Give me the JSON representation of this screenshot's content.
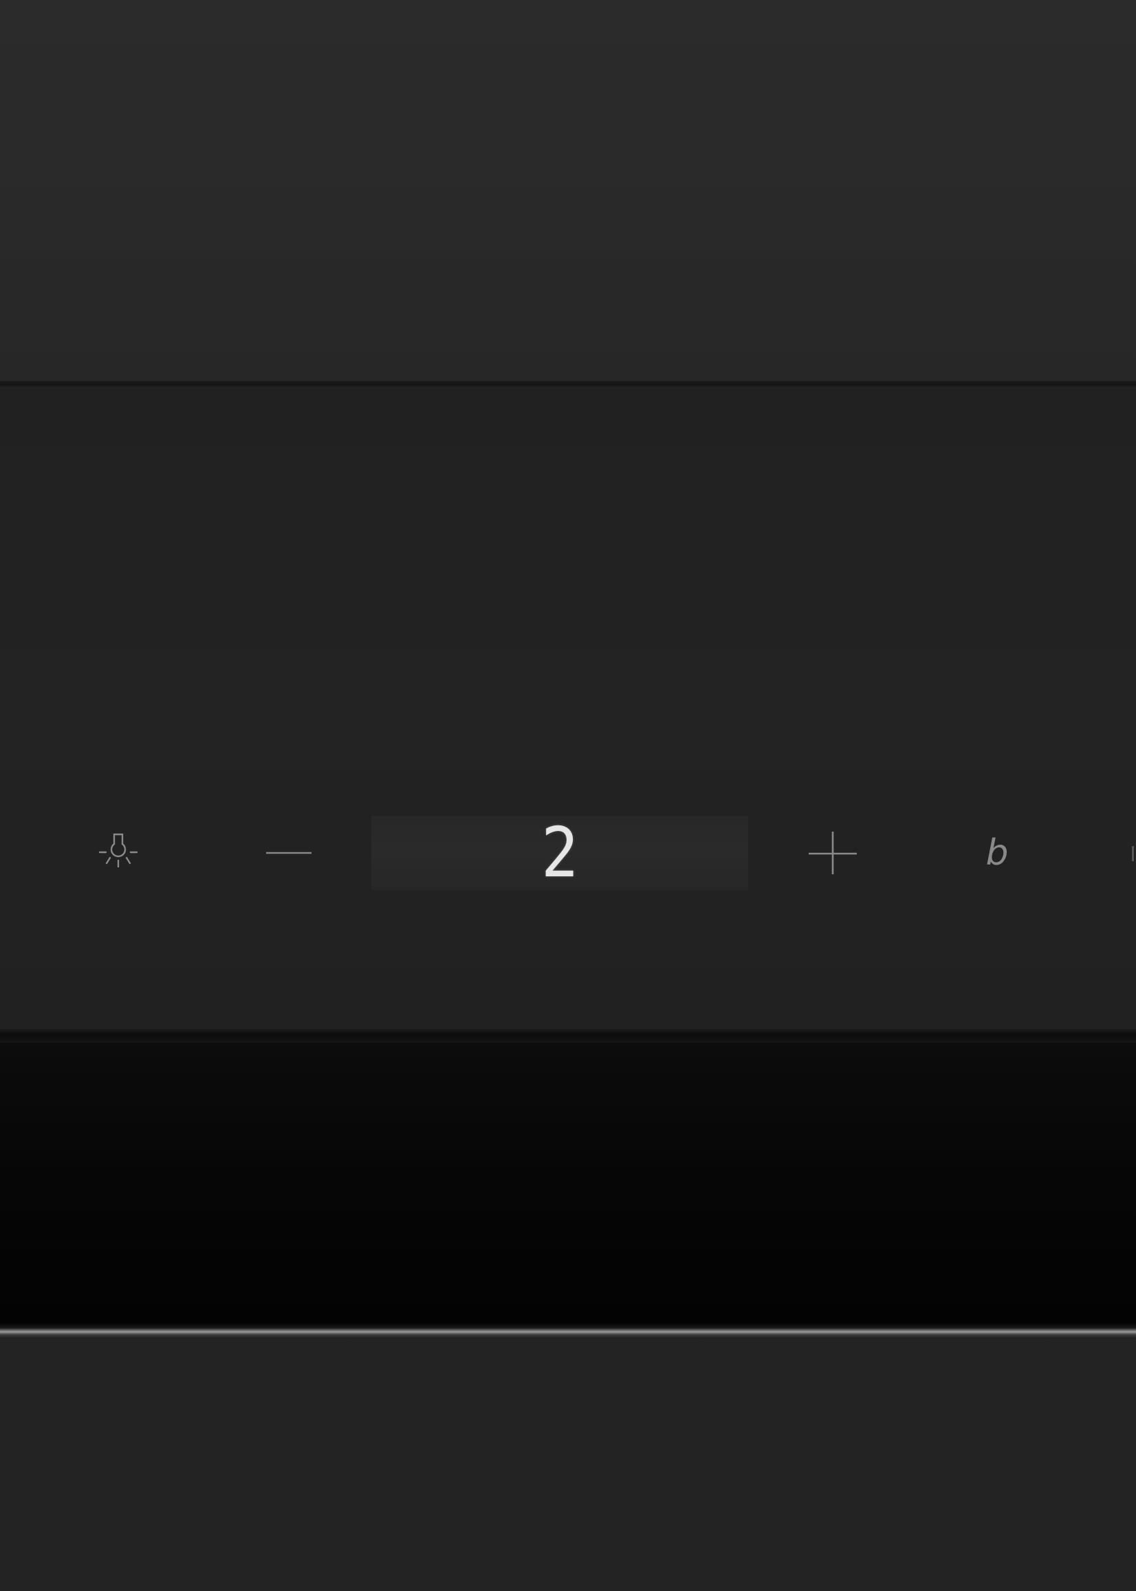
{
  "panel": {
    "display_value": "2",
    "boost_label": "b",
    "colors": {
      "panel": "#232323",
      "glass": "#050505",
      "symbol": "#8a8a8a",
      "display_digit": "#e6e6e6"
    }
  },
  "icons": {
    "light": "light-bulb-icon",
    "minus": "minus-icon",
    "plus": "plus-icon"
  }
}
